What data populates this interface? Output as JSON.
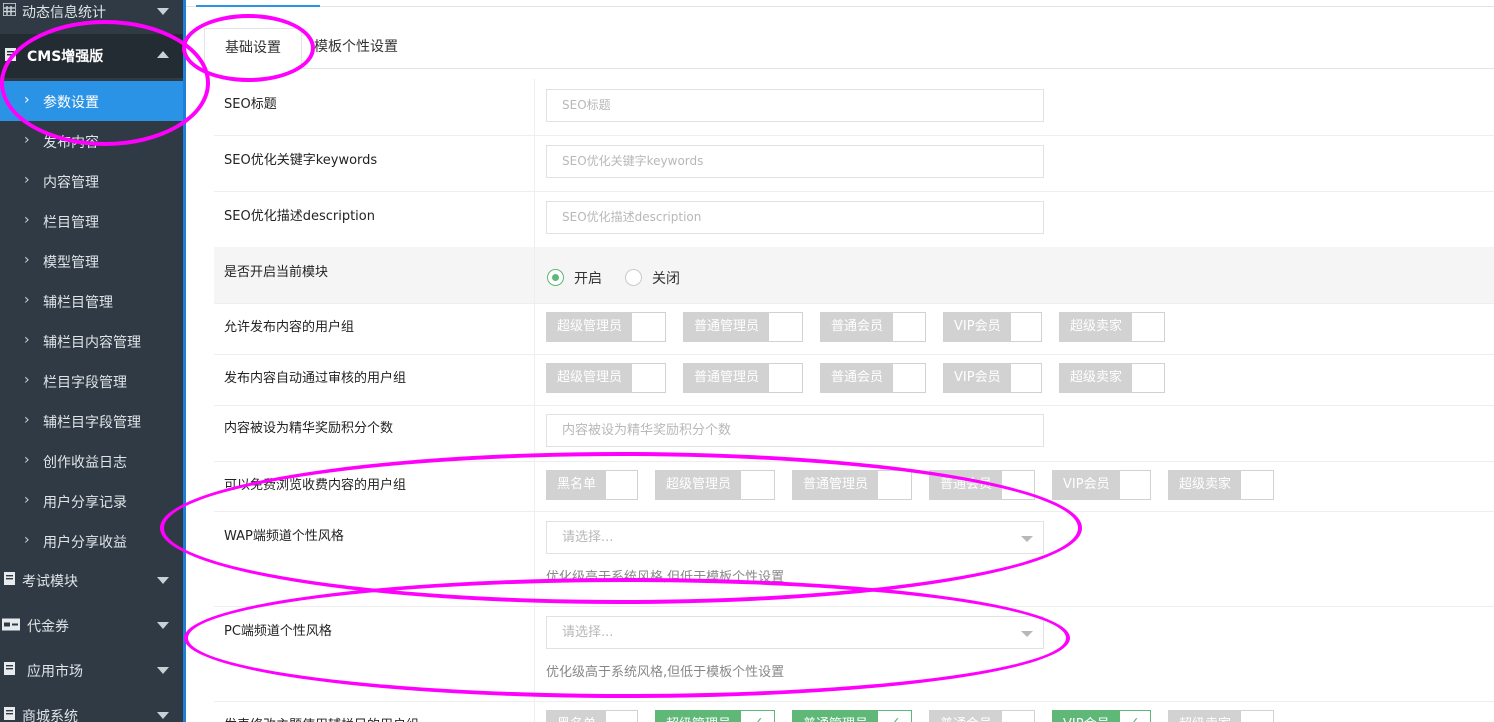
{
  "sidebar": {
    "groups_top": [
      {
        "label": "动态信息统计",
        "icon": "chart-icon"
      },
      {
        "label": "CMS增强版",
        "icon": "document-icon"
      }
    ],
    "items": [
      {
        "label": "参数设置"
      },
      {
        "label": "发布内容"
      },
      {
        "label": "内容管理"
      },
      {
        "label": "栏目管理"
      },
      {
        "label": "模型管理"
      },
      {
        "label": "辅栏目管理"
      },
      {
        "label": "辅栏目内容管理"
      },
      {
        "label": "栏目字段管理"
      },
      {
        "label": "辅栏目字段管理"
      },
      {
        "label": "创作收益日志"
      },
      {
        "label": "用户分享记录"
      },
      {
        "label": "用户分享收益"
      }
    ],
    "groups_bottom": [
      {
        "label": "考试模块",
        "icon": "document-icon"
      },
      {
        "label": "代金券",
        "icon": "coupon-icon"
      },
      {
        "label": "应用市场",
        "icon": "document-icon"
      },
      {
        "label": "商城系统",
        "icon": "document-icon"
      }
    ],
    "active_index": 0
  },
  "tabs": [
    {
      "label": "基础设置"
    },
    {
      "label": "模板个性设置"
    }
  ],
  "form": {
    "seo_title": {
      "label": "SEO标题",
      "placeholder": "SEO标题"
    },
    "seo_keywords": {
      "label": "SEO优化关键字keywords",
      "placeholder": "SEO优化关键字keywords"
    },
    "seo_description": {
      "label": "SEO优化描述description",
      "placeholder": "SEO优化描述description"
    },
    "module_enabled": {
      "label": "是否开启当前模块",
      "options": [
        "开启",
        "关闭"
      ],
      "selected": "开启"
    },
    "publish_groups": {
      "label": "允许发布内容的用户组",
      "options": [
        "超级管理员",
        "普通管理员",
        "普通会员",
        "VIP会员",
        "超级卖家"
      ]
    },
    "auto_approve_groups": {
      "label": "发布内容自动通过审核的用户组",
      "options": [
        "超级管理员",
        "普通管理员",
        "普通会员",
        "VIP会员",
        "超级卖家"
      ]
    },
    "essence_points": {
      "label": "内容被设为精华奖励积分个数",
      "placeholder": "内容被设为精华奖励积分个数"
    },
    "free_view_groups": {
      "label": "可以免费浏览收费内容的用户组",
      "options": [
        "黑名单",
        "超级管理员",
        "普通管理员",
        "普通会员",
        "VIP会员",
        "超级卖家"
      ]
    },
    "wap_style": {
      "label": "WAP端频道个性风格",
      "placeholder": "请选择...",
      "hint": "优化级高于系统风格,但低于模板个性设置"
    },
    "pc_style": {
      "label": "PC端频道个性风格",
      "placeholder": "请选择...",
      "hint": "优化级高于系统风格,但低于模板个性设置"
    },
    "aux_column_groups": {
      "label": "发表修改主题使用辅栏目的用户组",
      "options": [
        "黑名单",
        "超级管理员",
        "普通管理员",
        "普通会员",
        "VIP会员",
        "超级卖家"
      ],
      "checked": [
        "超级管理员",
        "普通管理员",
        "VIP会员"
      ]
    }
  },
  "colors": {
    "sidebar_bg": "#2f3a45",
    "active_bg": "#2b93e6",
    "check_green": "#5fb878",
    "annotation": "#ff00ff"
  }
}
